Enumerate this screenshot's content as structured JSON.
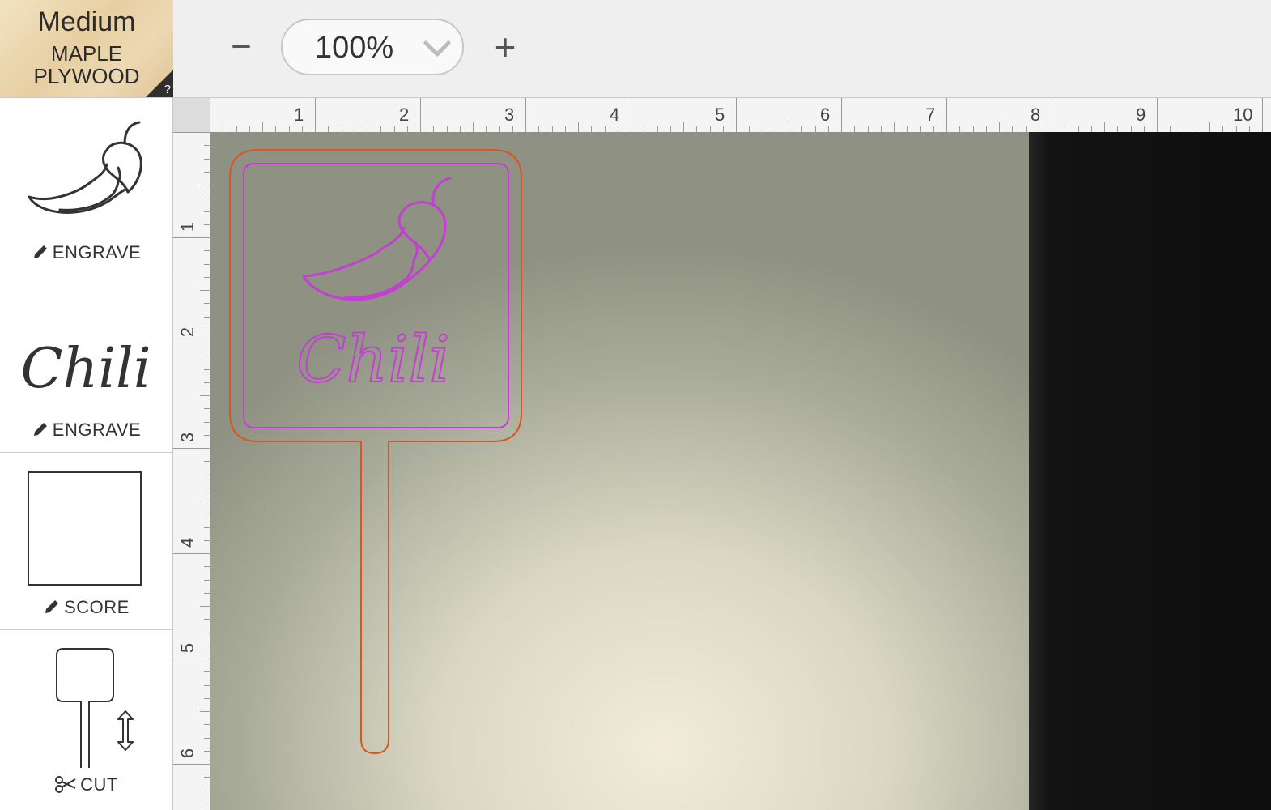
{
  "material": {
    "thickness": "Medium",
    "name_line1": "MAPLE",
    "name_line2": "PLYWOOD",
    "help_label": "?"
  },
  "zoom": {
    "value": "100%",
    "out_icon": "minus-icon",
    "in_icon": "plus-icon",
    "out_label": "−",
    "in_label": "+"
  },
  "operations": [
    {
      "label": "ENGRAVE",
      "icon": "pencil-icon",
      "thumb": "chili-pepper-icon"
    },
    {
      "label": "ENGRAVE",
      "icon": "pencil-icon",
      "thumb": "chili-text",
      "thumb_text": "Chili"
    },
    {
      "label": "SCORE",
      "icon": "pencil-icon",
      "thumb": "square-outline"
    },
    {
      "label": "CUT",
      "icon": "scissors-icon",
      "thumb": "sign-stake-outline"
    }
  ],
  "ruler": {
    "top": [
      "1",
      "2",
      "3",
      "4",
      "5",
      "6",
      "7",
      "8",
      "9",
      "10"
    ],
    "left": [
      "1",
      "2",
      "3",
      "4",
      "5",
      "6"
    ]
  },
  "design": {
    "text": "Chili",
    "engrave_color": "#c23fd2",
    "cut_color": "#d8561f"
  },
  "colors": {
    "bed_light": "#e9e5d0",
    "bed_dark": "#111211",
    "toolbar": "#efefef"
  }
}
